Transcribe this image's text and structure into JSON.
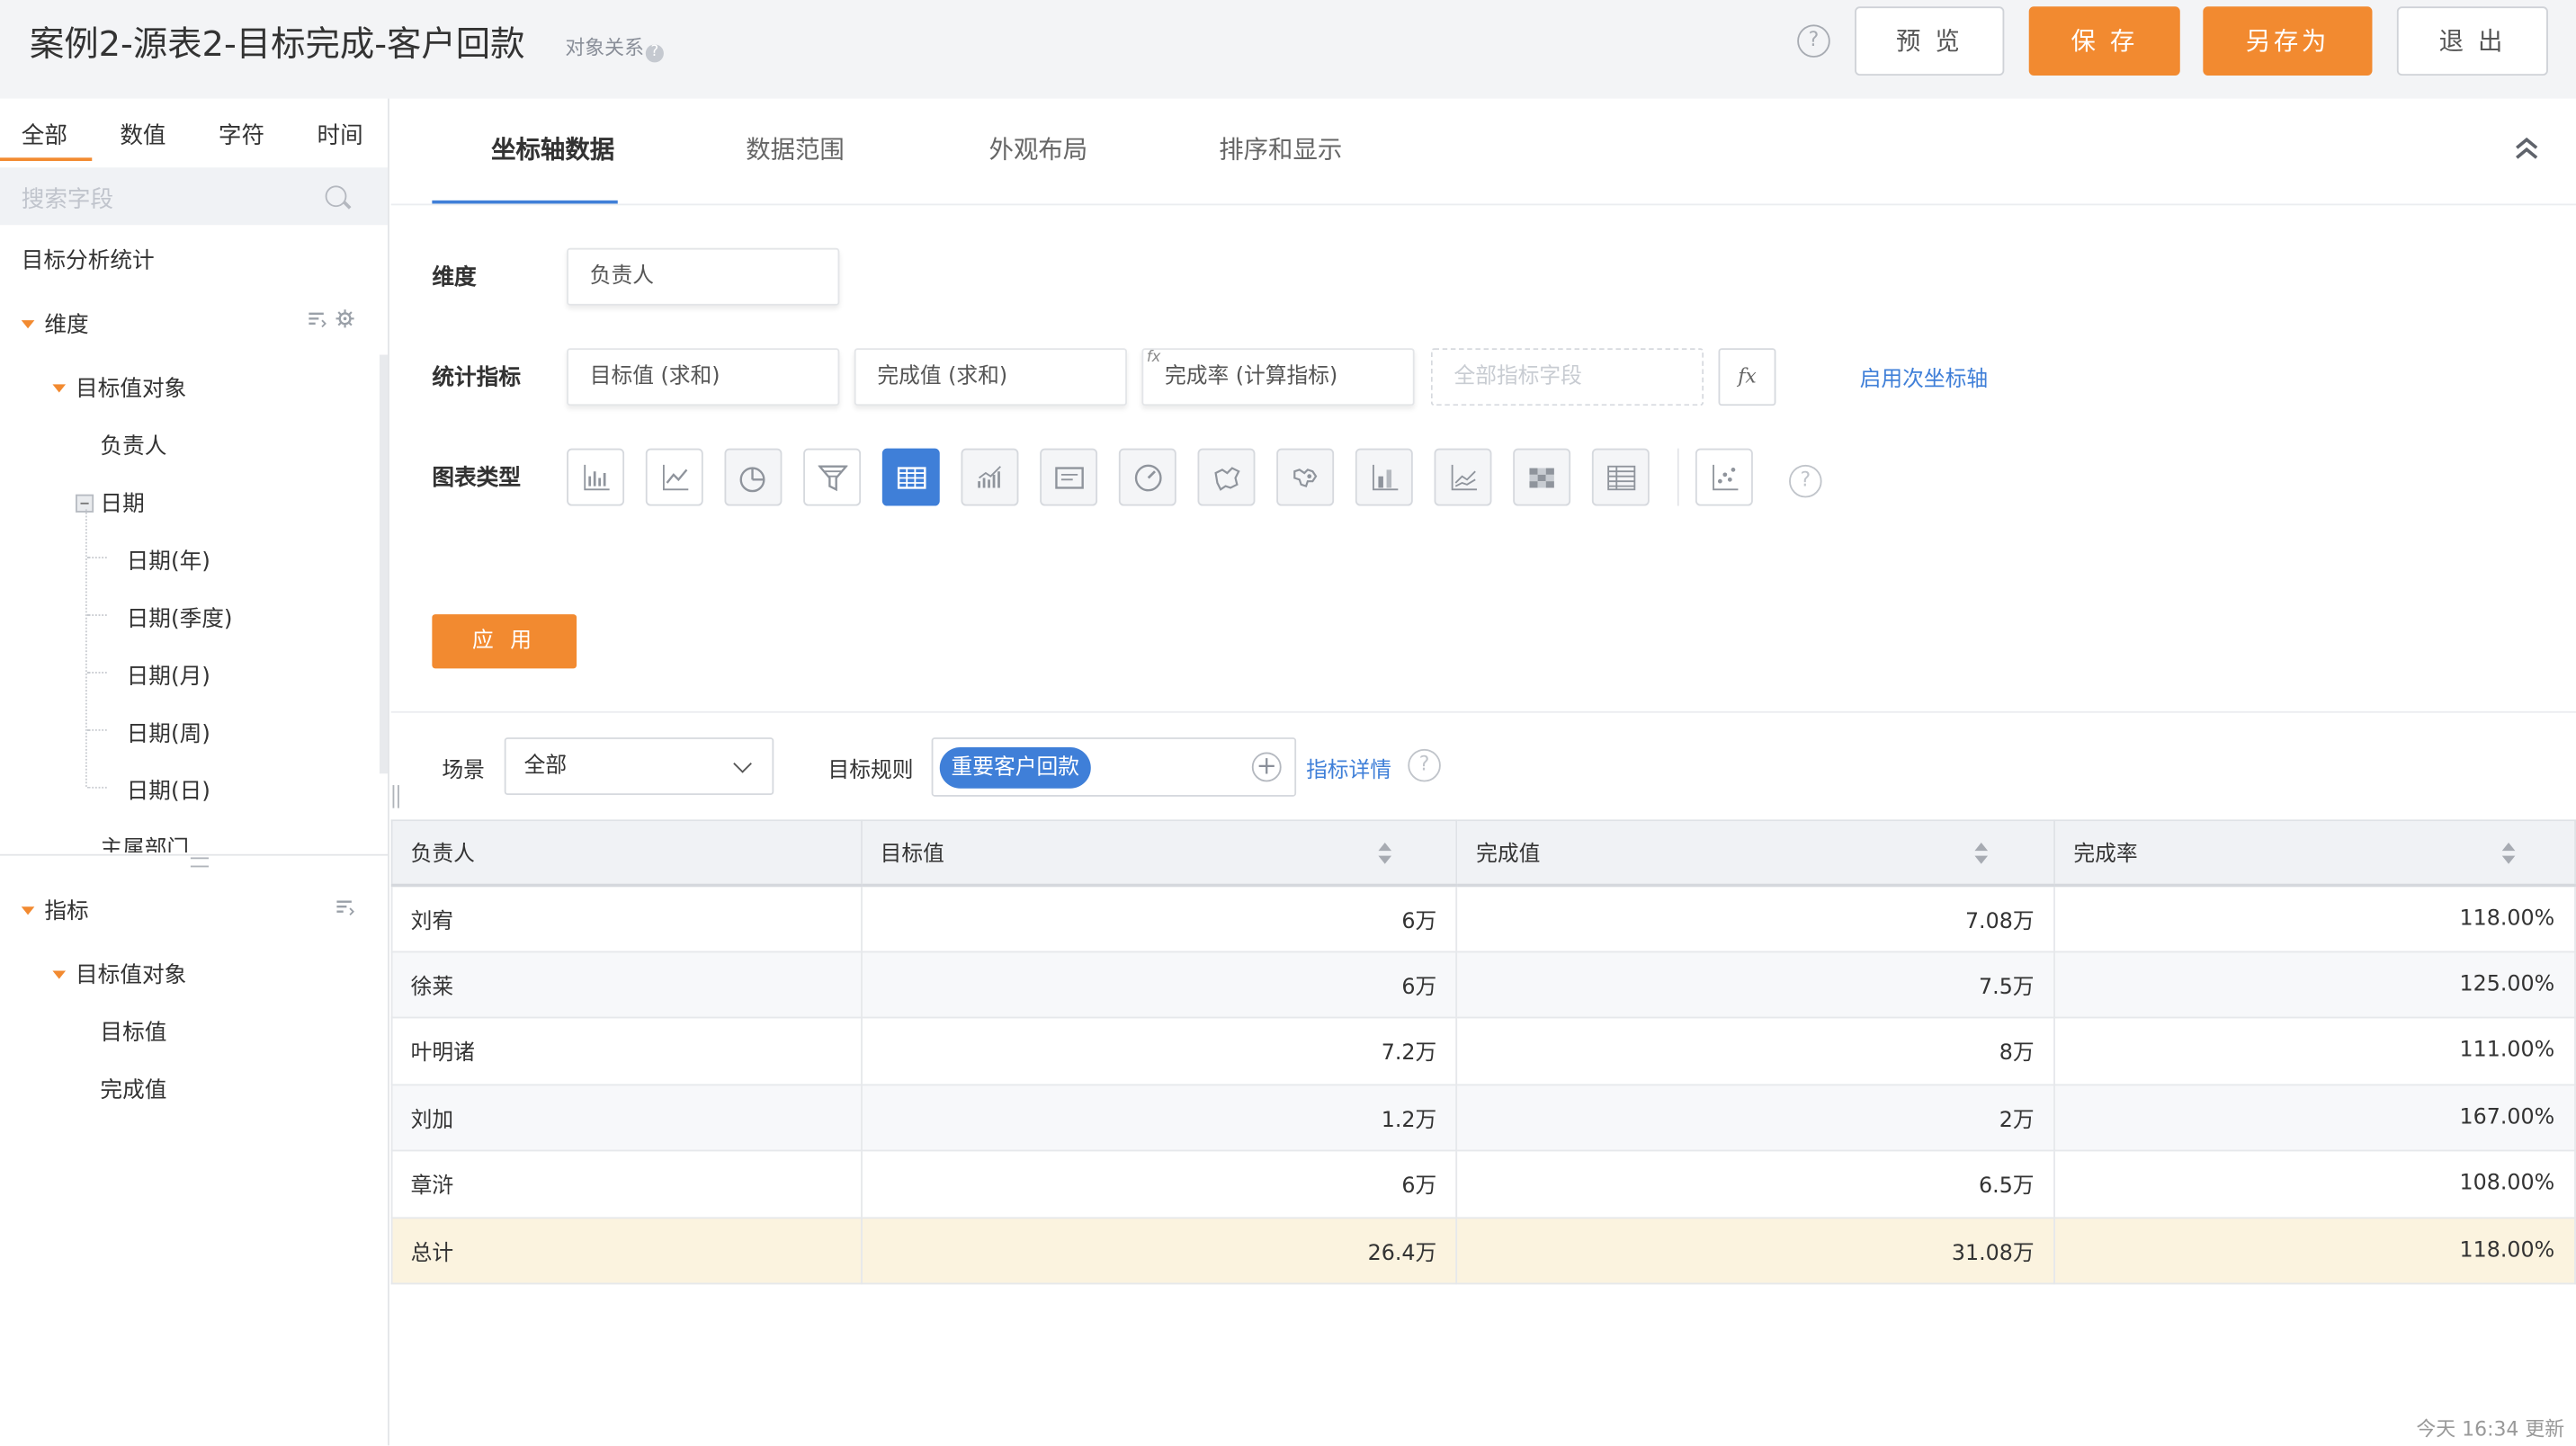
{
  "header": {
    "title": "案例2-源表2-目标完成-客户回款",
    "relation_label": "对象关系",
    "help_glyph": "?",
    "buttons": {
      "preview": "预 览",
      "save": "保 存",
      "save_as": "另存为",
      "exit": "退 出"
    },
    "colors": {
      "accent": "#f28a30",
      "primary_blue": "#3f7fd8"
    }
  },
  "sidebar": {
    "tabs": [
      "全部",
      "数值",
      "字符",
      "时间"
    ],
    "active_tab": "全部",
    "search_placeholder": "搜索字段",
    "group_title": "目标分析统计",
    "dimension": {
      "label": "维度",
      "object": "目标值对象",
      "owner": "负责人",
      "date": "日期",
      "date_children": [
        "日期(年)",
        "日期(季度)",
        "日期(月)",
        "日期(周)",
        "日期(日)"
      ],
      "department": "主属部门"
    },
    "metric": {
      "label": "指标",
      "object": "目标值对象",
      "items": [
        "目标值",
        "完成值"
      ]
    }
  },
  "main": {
    "tabs": [
      "坐标轴数据",
      "数据范围",
      "外观布局",
      "排序和显示"
    ],
    "active_tab": "坐标轴数据",
    "dimension_label": "维度",
    "dimension_value": "负责人",
    "metric_label": "统计指标",
    "metrics": [
      "目标值 (求和)",
      "完成值 (求和)",
      "完成率 (计算指标)"
    ],
    "metric_placeholder": "全部指标字段",
    "fx_label": "fx",
    "secondary_axis_link": "启用次坐标轴",
    "chart_type_label": "图表类型",
    "chart_types": [
      "bar-chart-icon",
      "line-chart-icon",
      "pie-chart-icon",
      "funnel-chart-icon",
      "table-chart-icon",
      "area-chart-icon",
      "card-chart-icon",
      "gauge-chart-icon",
      "map-chart-icon",
      "world-map-icon",
      "stacked-bar-icon",
      "multi-line-icon",
      "heatmap-icon",
      "pivot-table-icon",
      "scatter-chart-icon"
    ],
    "selected_chart_type": "table-chart-icon",
    "apply_label": "应 用",
    "filters": {
      "scene_label": "场景",
      "scene_value": "全部",
      "rule_label": "目标规则",
      "rule_tag": "重要客户回款",
      "detail_link": "指标详情"
    }
  },
  "table": {
    "columns": [
      "负责人",
      "目标值",
      "完成值",
      "完成率"
    ],
    "rows": [
      {
        "name": "刘宥",
        "target": "6万",
        "done": "7.08万",
        "rate": "118.00%"
      },
      {
        "name": "徐莱",
        "target": "6万",
        "done": "7.5万",
        "rate": "125.00%"
      },
      {
        "name": "叶明诸",
        "target": "7.2万",
        "done": "8万",
        "rate": "111.00%"
      },
      {
        "name": "刘加",
        "target": "1.2万",
        "done": "2万",
        "rate": "167.00%"
      },
      {
        "name": "章浒",
        "target": "6万",
        "done": "6.5万",
        "rate": "108.00%"
      }
    ],
    "total": {
      "name": "总计",
      "target": "26.4万",
      "done": "31.08万",
      "rate": "118.00%"
    }
  },
  "footer": {
    "updated": "今天 16:34 更新"
  }
}
